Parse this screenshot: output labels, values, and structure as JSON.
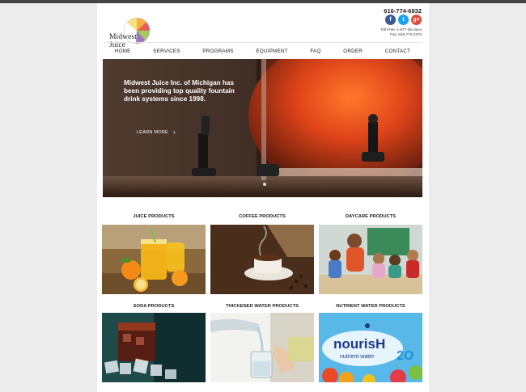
{
  "header": {
    "logo_text": "Midwest Juice",
    "phone": "616-774-6832",
    "tollfree": "Toll Free: 1-877-26-Juice",
    "fax": "Fax: 616-774-2373",
    "social": [
      {
        "icon": "facebook-icon",
        "glyph": "f"
      },
      {
        "icon": "twitter-icon",
        "glyph": "t"
      },
      {
        "icon": "google-plus-icon",
        "glyph": "g+"
      }
    ]
  },
  "nav": {
    "items": [
      "HOME",
      "SERVICES",
      "PROGRAMS",
      "EQUIPMENT",
      "FAQ",
      "ORDER",
      "CONTACT"
    ]
  },
  "hero": {
    "headline": "Midwest Juice Inc. of Michigan has been providing top quality fountain drink systems since 1998.",
    "cta": "LEARN MORE",
    "cta_chevron": "›"
  },
  "products": [
    {
      "label": "JUICE PRODUCTS"
    },
    {
      "label": "COFFEE PRODUCTS"
    },
    {
      "label": "DAYCARE PRODUCTS"
    },
    {
      "label": "SODA PRODUCTS"
    },
    {
      "label": "THICKENED WATER PRODUCTS"
    },
    {
      "label": "NUTRIENT WATER PRODUCTS"
    }
  ],
  "nourish": {
    "brand": "nourisH",
    "sub": "nutrient water",
    "tail": "2O"
  }
}
